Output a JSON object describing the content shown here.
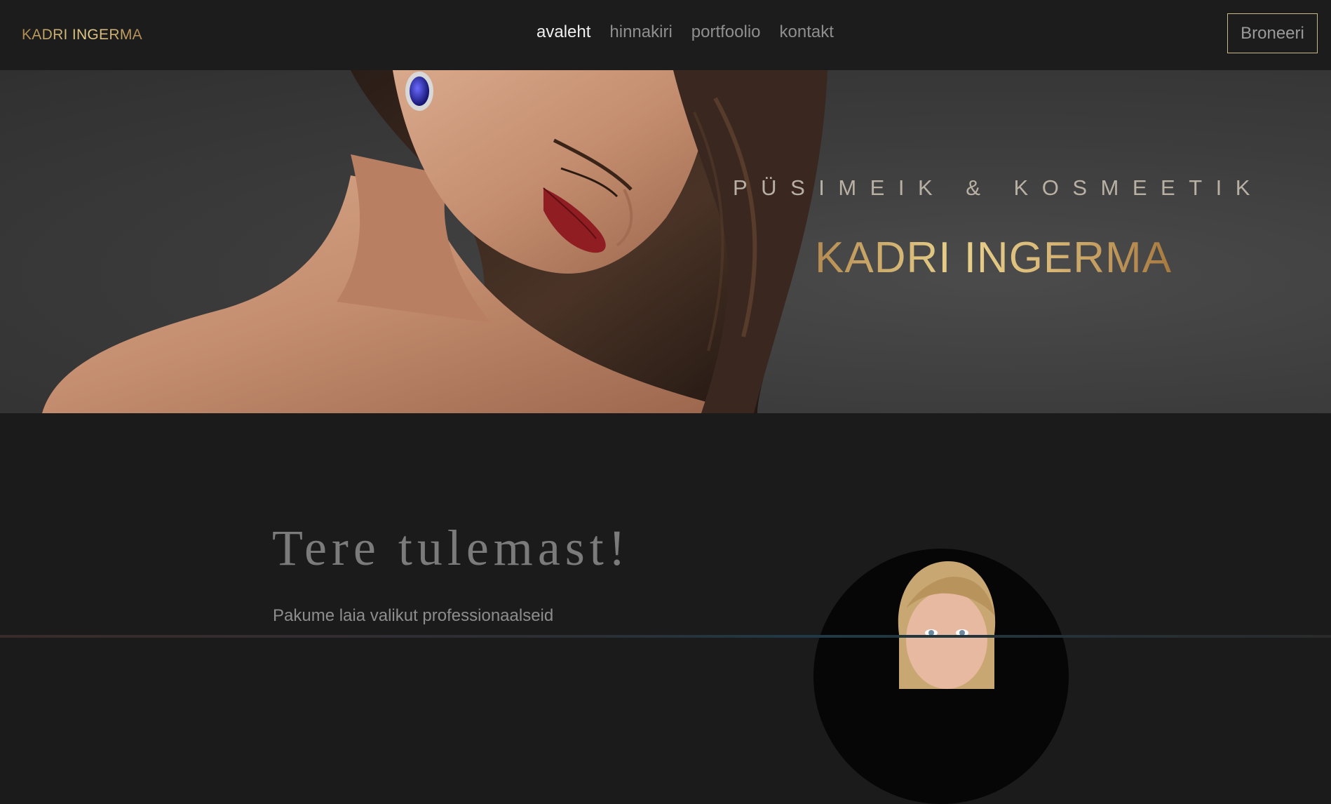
{
  "header": {
    "logo_text": "KADRI INGERMA",
    "nav": [
      {
        "label": "avaleht",
        "active": true
      },
      {
        "label": "hinnakiri",
        "active": false
      },
      {
        "label": "portfoolio",
        "active": false
      },
      {
        "label": "kontakt",
        "active": false
      }
    ],
    "book_button": "Broneeri"
  },
  "hero": {
    "subtitle": "PÜSIMEIK & KOSMEETIK",
    "title": "KADRI INGERMA"
  },
  "welcome": {
    "title": "Tere tulemast!",
    "text": "Pakume laia valikut professionaalseid"
  },
  "colors": {
    "gold": "#c8a86e",
    "background": "#1b1b1b",
    "accent_border": "#c7b98a"
  }
}
